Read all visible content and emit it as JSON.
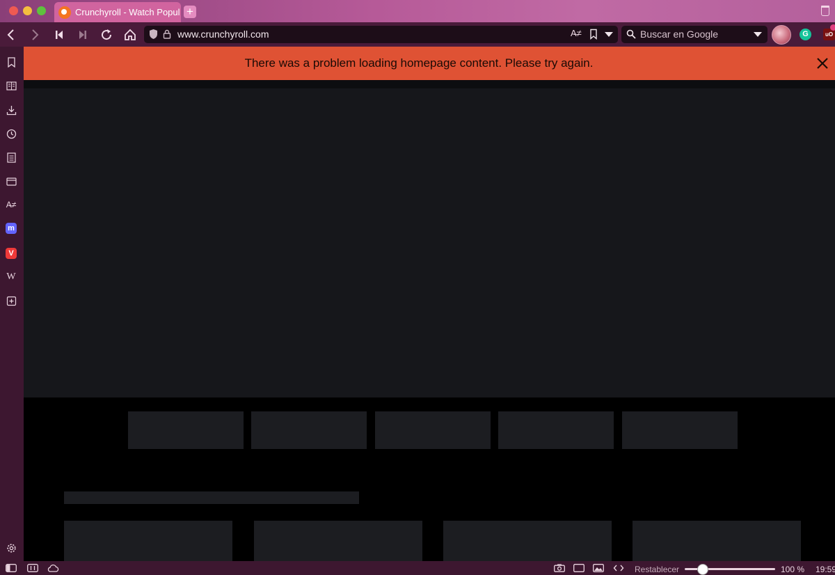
{
  "tab": {
    "title": "Crunchyroll - Watch Popul"
  },
  "address": {
    "url": "www.crunchyroll.com"
  },
  "search": {
    "placeholder": "Buscar en Google"
  },
  "banner": {
    "message": "There was a problem loading homepage content. Please try again."
  },
  "statusbar": {
    "reset_label": "Restablecer",
    "zoom": "100 %",
    "time": "19:59"
  },
  "icons": {
    "navbar": [
      "back-icon",
      "forward-icon",
      "rewind-icon",
      "fast-forward-icon",
      "reload-icon",
      "home-icon",
      "shield-icon",
      "lock-icon",
      "translate-icon",
      "bookmark-icon",
      "search-icon"
    ],
    "sidebar": [
      "bookmarks-icon",
      "reading-list-icon",
      "downloads-icon",
      "history-icon",
      "notes-icon",
      "window-icon",
      "translate-icon",
      "mastodon-icon",
      "vivaldi-icon",
      "wikipedia-icon",
      "add-panel-icon",
      "settings-icon"
    ]
  },
  "colors": {
    "banner": "#df5234",
    "tabbar": "#b65a98",
    "addressbar": "#4a1b3a",
    "sidebar": "#3d1730",
    "accent": "#f47521"
  }
}
